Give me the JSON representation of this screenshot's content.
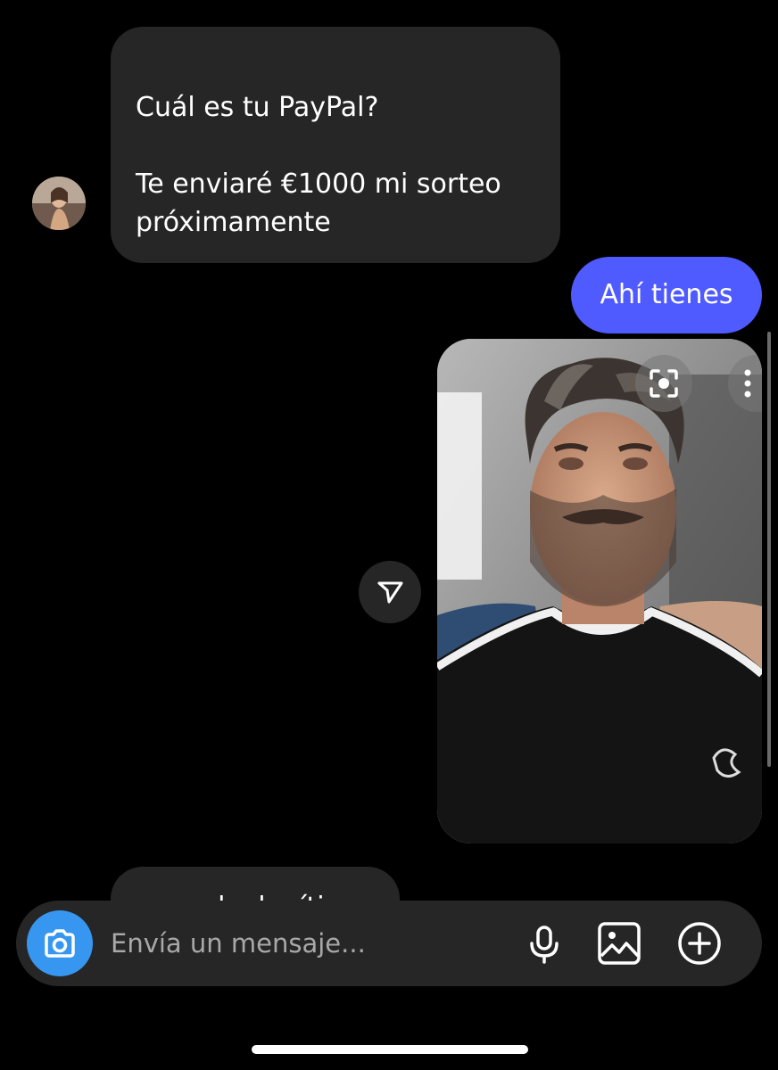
{
  "thread": {
    "incoming": {
      "text": "Cuál es tu PayPal?\n\nTe enviaré €1000 mi sorteo próximamente"
    },
    "outgoing": {
      "text": "Ahí tienes"
    },
    "partial_incoming": {
      "text": "es real y legítimo"
    }
  },
  "composer": {
    "placeholder": "Envía un mensaje..."
  },
  "icons": {
    "camera": "camera-icon",
    "mic": "microphone-icon",
    "gallery": "gallery-icon",
    "add": "plus-circle-icon",
    "share": "send-icon",
    "lens": "visual-search-icon",
    "more": "more-vertical-icon"
  },
  "colors": {
    "background": "#000000",
    "incoming_bubble": "#262626",
    "outgoing_bubble": "#4f5bff",
    "camera_button": "#3797f0",
    "placeholder": "#a8a8a8"
  }
}
